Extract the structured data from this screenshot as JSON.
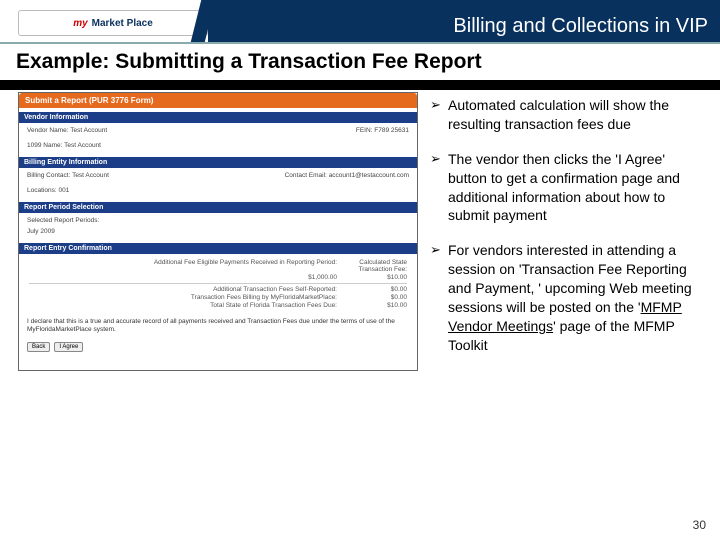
{
  "header": {
    "logo_left": "my",
    "logo_right": "Market Place",
    "page_title": "Billing and Collections in VIP"
  },
  "subheading": "Example:  Submitting a Transaction Fee Report",
  "form": {
    "submit_band": "Submit a Report (PUR 3776 Form)",
    "vendor_band": "Vendor Information",
    "vendor_name_label": "Vendor Name:",
    "vendor_name_value": "Test Account",
    "fein_label": "FEIN:",
    "fein_value": "F789 25631",
    "w9_label": "1099 Name:",
    "w9_value": "Test Account",
    "billing_band": "Billing Entity Information",
    "billing_contact_label": "Billing Contact:",
    "billing_contact_value": "Test Account",
    "contact_email_label": "Contact Email:",
    "contact_email_value": "account1@testaccount.com",
    "locations_label": "Locations:",
    "locations_value": "001",
    "period_band": "Report Period Selection",
    "period_label": "Selected Report Periods:",
    "period_value": "July 2009",
    "confirm_band": "Report Entry Confirmation",
    "calc": [
      {
        "c1": "Additional Fee Eligible Payments Received in Reporting Period:",
        "c2": "Calculated State Transaction Fee:"
      },
      {
        "c1": "$1,000.00",
        "c2": "$10.00"
      },
      {
        "c1": "Additional Transaction Fees Self-Reported:",
        "c2": "$0.00"
      },
      {
        "c1": "Transaction Fees Billing by MyFloridaMarketPlace:",
        "c2": "$0.00"
      },
      {
        "c1": "Total State of Florida Transaction Fees Due:",
        "c2": "$10.00"
      }
    ],
    "declaration": "I declare that this is a true and accurate record of all payments received and Transaction Fees due under the terms of use of the MyFloridaMarketPlace system.",
    "btn_back": "Back",
    "btn_agree": "I Agree"
  },
  "bullets": [
    {
      "text": "Automated calculation will show the resulting transaction fees due"
    },
    {
      "text": "The vendor then clicks the 'I Agree' button to get a confirmation page and additional information about how to submit payment"
    },
    {
      "text_before": "For vendors interested in attending a session on 'Transaction Fee Reporting and Payment, ' upcoming Web meeting sessions will be posted on the '",
      "link": "MFMP Vendor Meetings",
      "text_after": "' page of the MFMP Toolkit"
    }
  ],
  "page_number": "30"
}
